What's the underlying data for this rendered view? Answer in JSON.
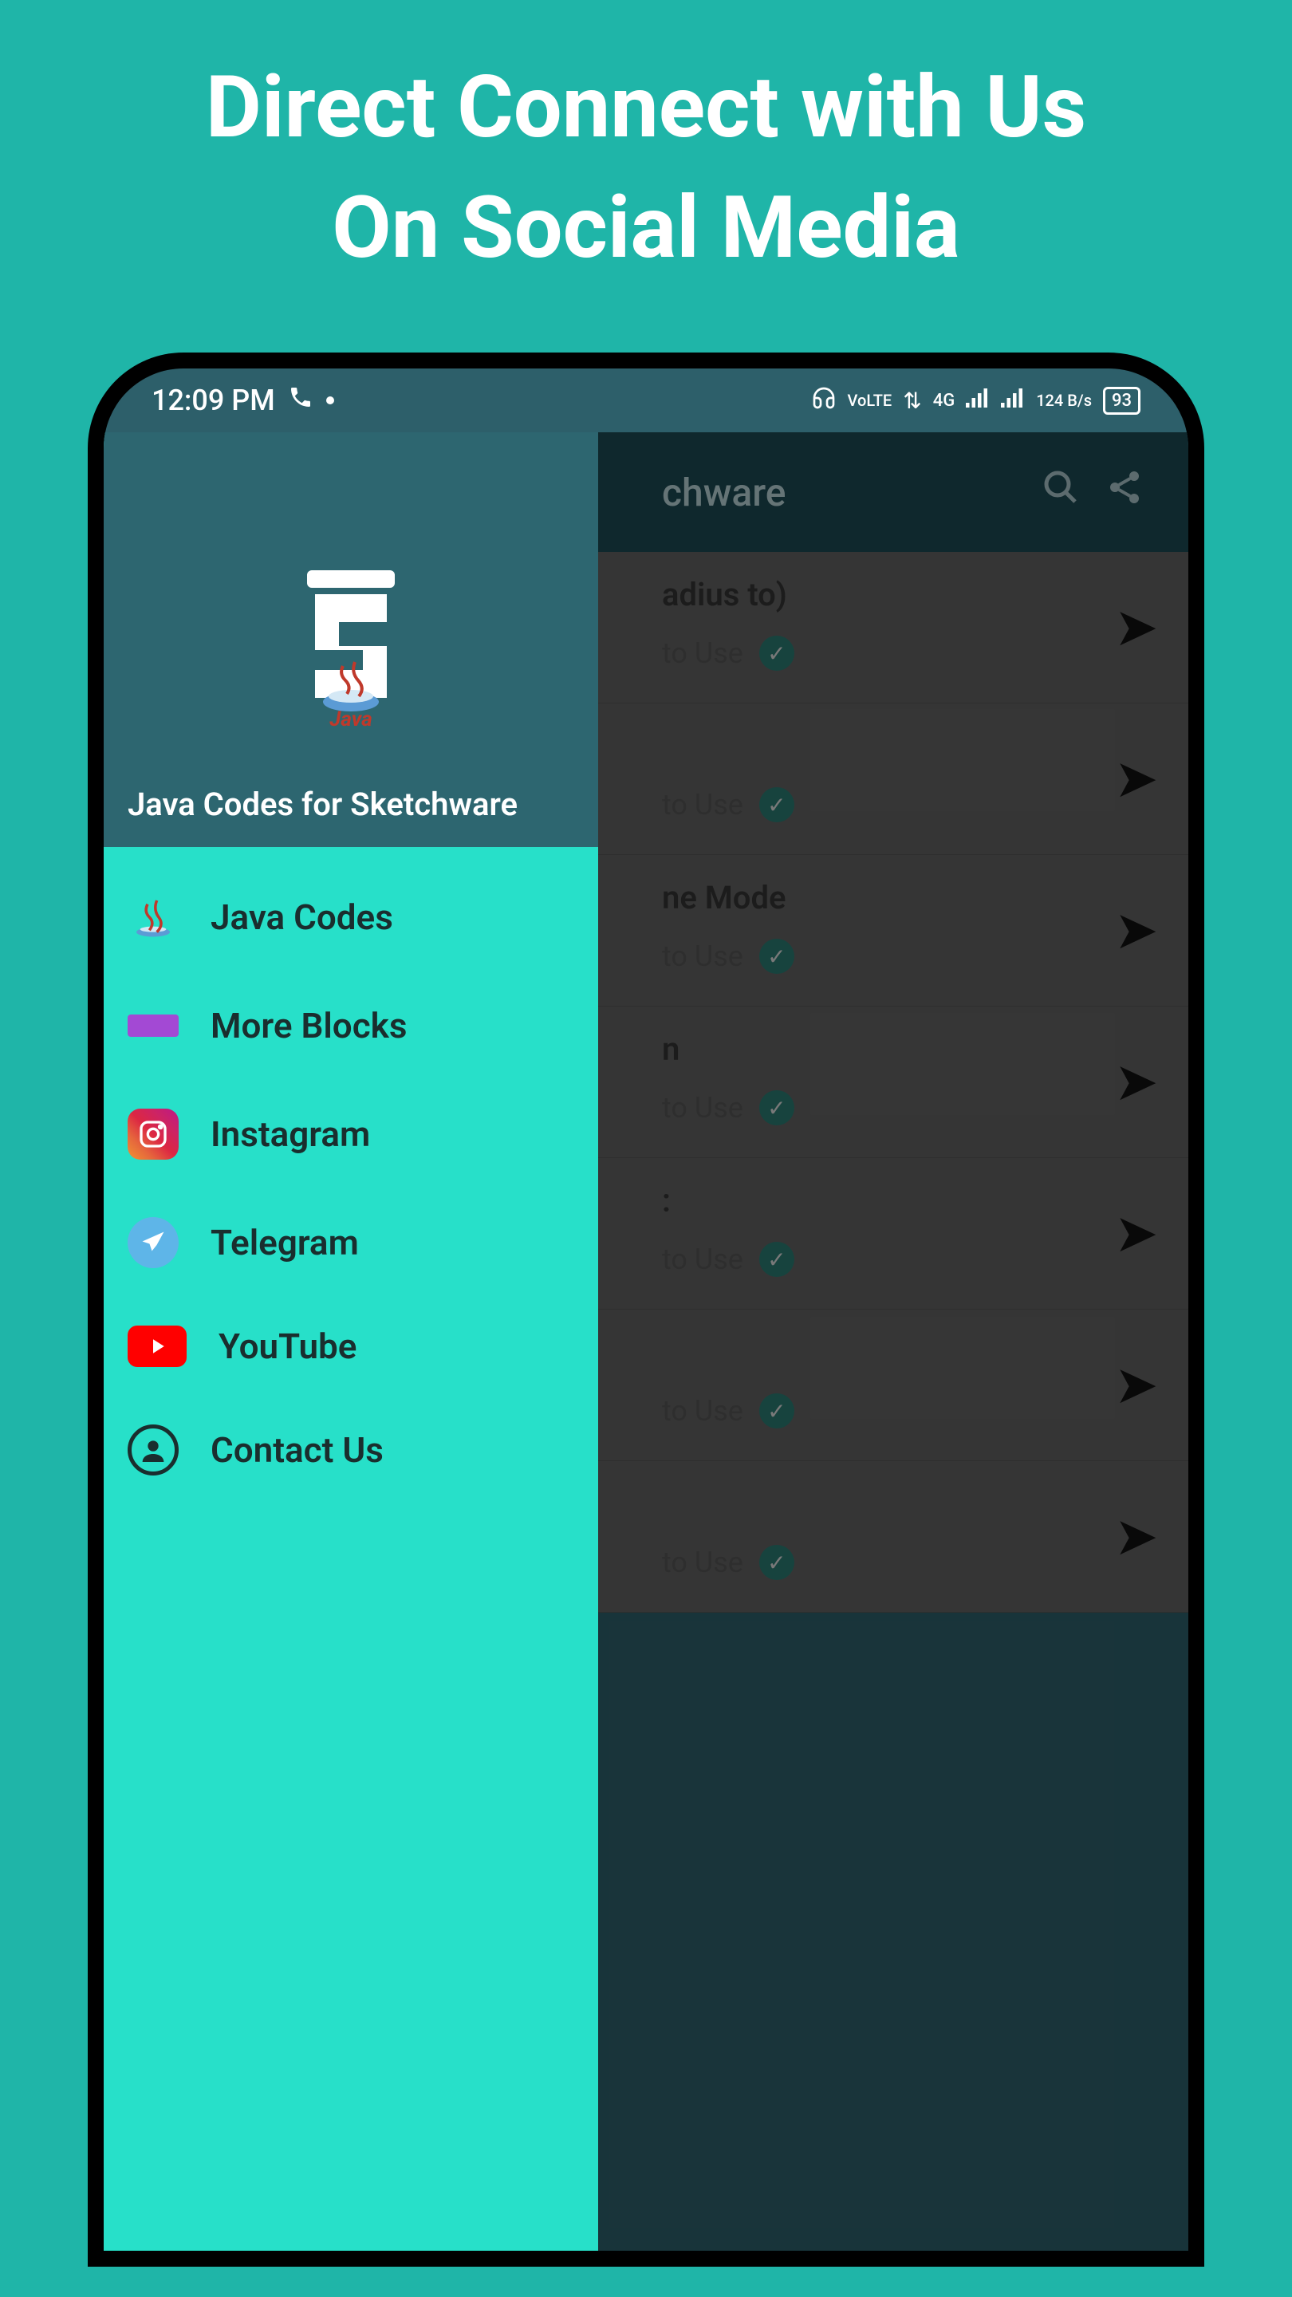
{
  "promo": {
    "line1": "Direct Connect with Us",
    "line2": "On Social Media"
  },
  "statusBar": {
    "time": "12:09 PM",
    "network": "VoLTE",
    "signal": "4G",
    "speed": "124 B/s",
    "battery": "93"
  },
  "appBar": {
    "titleFragment": "chware"
  },
  "list": {
    "subLabel": "to Use",
    "items": [
      {
        "textFragment": "adius to)"
      },
      {
        "textFragment": ""
      },
      {
        "textFragment": "ne Mode"
      },
      {
        "textFragment": "n"
      },
      {
        "textFragment": ":"
      },
      {
        "textFragment": ""
      },
      {
        "textFragment": ""
      }
    ]
  },
  "drawer": {
    "title": "Java Codes for Sketchware",
    "items": [
      {
        "label": "Java Codes",
        "icon": "java"
      },
      {
        "label": "More Blocks",
        "icon": "blocks"
      },
      {
        "label": "Instagram",
        "icon": "instagram"
      },
      {
        "label": "Telegram",
        "icon": "telegram"
      },
      {
        "label": "YouTube",
        "icon": "youtube"
      },
      {
        "label": "Contact Us",
        "icon": "contact"
      }
    ]
  }
}
